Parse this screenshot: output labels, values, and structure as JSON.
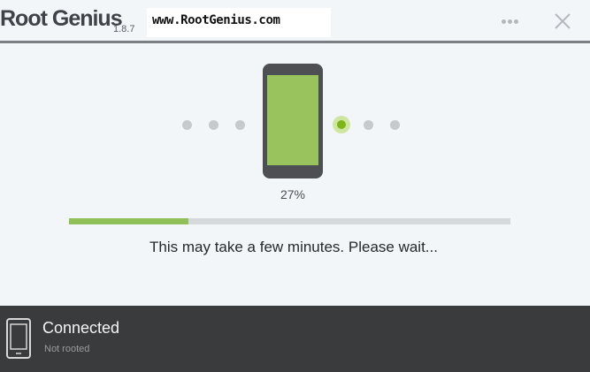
{
  "header": {
    "app_name": "Root Genius",
    "version": "1.8.7",
    "website": "www.RootGenius.com",
    "more_icon": "more-dots-icon",
    "close_icon": "close-icon"
  },
  "main": {
    "progress_percent_label": "27%",
    "progress": 0.27,
    "message": "This may take a few minutes. Please wait...",
    "phone_icon": "phone-icon",
    "step_dots": {
      "total": 6,
      "active_index": 3
    }
  },
  "footer": {
    "status_title": "Connected",
    "status_subtitle": "Not rooted",
    "device_icon": "device-icon"
  },
  "colors": {
    "accent_green": "#8fc158",
    "active_dot": "#7cb518",
    "phone_body": "#4d4f52",
    "footer_bg": "#3a3b3d",
    "background": "#f2f6f9"
  }
}
